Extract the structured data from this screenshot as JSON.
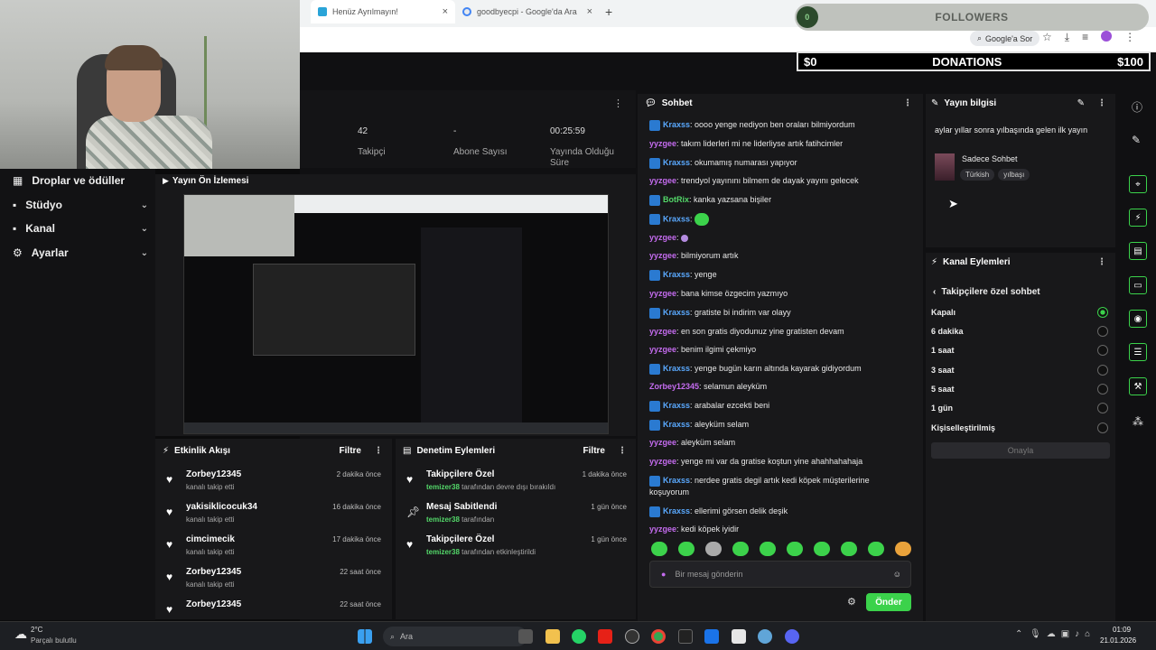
{
  "browser": {
    "tabs": [
      {
        "label": "Henüz Ayrılmayın!"
      },
      {
        "label": "goodbyecpi - Google'da Ara"
      }
    ],
    "google_search_label": "Google'a Sor"
  },
  "overlay": {
    "followers_label": "FOLLOWERS",
    "followers_count": "0",
    "donations_label": "DONATIONS",
    "donations_current": "$0",
    "donations_goal": "$100"
  },
  "stats": [
    {
      "value": "42",
      "label": "Takipçi"
    },
    {
      "value": "-",
      "label": "Abone Sayısı"
    },
    {
      "value": "00:25:59",
      "label": "Yayında Olduğu Süre"
    }
  ],
  "sidenav": {
    "items": [
      {
        "label": "Droplar ve ödüller"
      },
      {
        "label": "Stüdyo"
      },
      {
        "label": "Kanal"
      },
      {
        "label": "Ayarlar"
      }
    ]
  },
  "preview": {
    "title": "Yayın Ön İzlemesi"
  },
  "activity": {
    "title": "Etkinlik Akışı",
    "filter": "Filtre",
    "events": [
      {
        "name": "Zorbey12345",
        "sub": "kanalı takip etti",
        "time": "2 dakika önce"
      },
      {
        "name": "yakisiklicocuk34",
        "sub": "kanalı takip etti",
        "time": "16 dakika önce"
      },
      {
        "name": "cimcimecik",
        "sub": "kanalı takip etti",
        "time": "17 dakika önce"
      },
      {
        "name": "Zorbey12345",
        "sub": "kanalı takip etti",
        "time": "22 saat önce"
      },
      {
        "name": "Zorbey12345",
        "sub": "",
        "time": "22 saat önce"
      }
    ]
  },
  "moderation": {
    "title": "Denetim Eylemleri",
    "filter": "Filtre",
    "events": [
      {
        "name": "Takipçilere Özel",
        "user": "temizer38",
        "sub": " tarafından devre dışı bırakıldı",
        "time": "1 dakika önce"
      },
      {
        "name": "Mesaj Sabitlendi",
        "user": "temizer38",
        "sub": " tarafından",
        "time": "1 gün önce"
      },
      {
        "name": "Takipçilere Özel",
        "user": "temizer38",
        "sub": " tarafından etkinleştirildi",
        "time": "1 gün önce"
      }
    ]
  },
  "chat": {
    "title": "Sohbet",
    "messages": [
      {
        "user": "Kraxss",
        "color": "#5aa9ff",
        "badge": true,
        "text": "oooo yenge nediyon ben oraları bilmiyordum"
      },
      {
        "user": "yyzgee",
        "color": "#c56cf0",
        "badge": false,
        "text": "takım liderleri mi ne liderliyse artık fatihcimler"
      },
      {
        "user": "Kraxss",
        "color": "#5aa9ff",
        "badge": true,
        "text": "okumamış numarası yapıyor"
      },
      {
        "user": "yyzgee",
        "color": "#c56cf0",
        "badge": false,
        "text": "trendyol yayınını bilmem de dayak yayını gelecek"
      },
      {
        "user": "BotRix",
        "color": "#53d769",
        "badge": true,
        "text": "kanka yazsana bişiler"
      },
      {
        "user": "Kraxss",
        "color": "#5aa9ff",
        "badge": true,
        "text": ""
      },
      {
        "user": "yyzgee",
        "color": "#c56cf0",
        "badge": false,
        "text": ""
      },
      {
        "user": "yyzgee",
        "color": "#c56cf0",
        "badge": false,
        "text": "bilmiyorum artık"
      },
      {
        "user": "Kraxss",
        "color": "#5aa9ff",
        "badge": true,
        "text": "yenge"
      },
      {
        "user": "yyzgee",
        "color": "#c56cf0",
        "badge": false,
        "text": "bana kimse özgecim yazmıyo"
      },
      {
        "user": "Kraxss",
        "color": "#5aa9ff",
        "badge": true,
        "text": "gratiste bi indirim var olayy"
      },
      {
        "user": "yyzgee",
        "color": "#c56cf0",
        "badge": false,
        "text": "en son gratis diyodunuz yine gratisten devam"
      },
      {
        "user": "yyzgee",
        "color": "#c56cf0",
        "badge": false,
        "text": "benim ilgimi çekmiyo"
      },
      {
        "user": "Kraxss",
        "color": "#5aa9ff",
        "badge": true,
        "text": "yenge bugün karın altında kayarak gidiyordum"
      },
      {
        "user": "Zorbey12345",
        "color": "#c56cf0",
        "badge": false,
        "text": "selamun aleyküm"
      },
      {
        "user": "Kraxss",
        "color": "#5aa9ff",
        "badge": true,
        "text": "arabalar ezcekti beni"
      },
      {
        "user": "Kraxss",
        "color": "#5aa9ff",
        "badge": true,
        "text": "aleyküm selam"
      },
      {
        "user": "yyzgee",
        "color": "#c56cf0",
        "badge": false,
        "text": "aleyküm selam"
      },
      {
        "user": "yyzgee",
        "color": "#c56cf0",
        "badge": false,
        "text": "yenge mi var da gratise koştun yine ahahhahahaja"
      },
      {
        "user": "Kraxss",
        "color": "#5aa9ff",
        "badge": true,
        "text": "nerdee gratis degil artık kedi köpek müşterilerine koşuyorum"
      },
      {
        "user": "Kraxss",
        "color": "#5aa9ff",
        "badge": true,
        "text": "ellerimi görsen delik deşik"
      },
      {
        "user": "yyzgee",
        "color": "#c56cf0",
        "badge": false,
        "text": "kedi köpek iyidir"
      }
    ],
    "input_placeholder": "Bir mesaj gönderin",
    "send_label": "Önder"
  },
  "stream_info": {
    "title": "Yayın bilgisi",
    "stream_title": "aylar yıllar sonra yılbaşında gelen ilk yayın",
    "category": "Sadece Sohbet",
    "tags": [
      "Türkish",
      "yılbaşı"
    ]
  },
  "channel_actions": {
    "title": "Kanal Eylemleri",
    "sub_title": "Takipçilere özel sohbet",
    "options": [
      {
        "label": "Kapalı",
        "selected": true
      },
      {
        "label": "6 dakika",
        "selected": false
      },
      {
        "label": "1 saat",
        "selected": false
      },
      {
        "label": "3 saat",
        "selected": false
      },
      {
        "label": "5 saat",
        "selected": false
      },
      {
        "label": "1 gün",
        "selected": false
      },
      {
        "label": "Kişiselleştirilmiş",
        "selected": false
      }
    ],
    "confirm_label": "Onayla"
  },
  "taskbar": {
    "weather_temp": "2°C",
    "weather_desc": "Parçalı bulutlu",
    "search_label": "Ara",
    "time": "01:09",
    "date": "21.01.2026"
  },
  "colors": {
    "accent": "#3bd24b",
    "bg": "#101012",
    "panel": "#18181a"
  }
}
